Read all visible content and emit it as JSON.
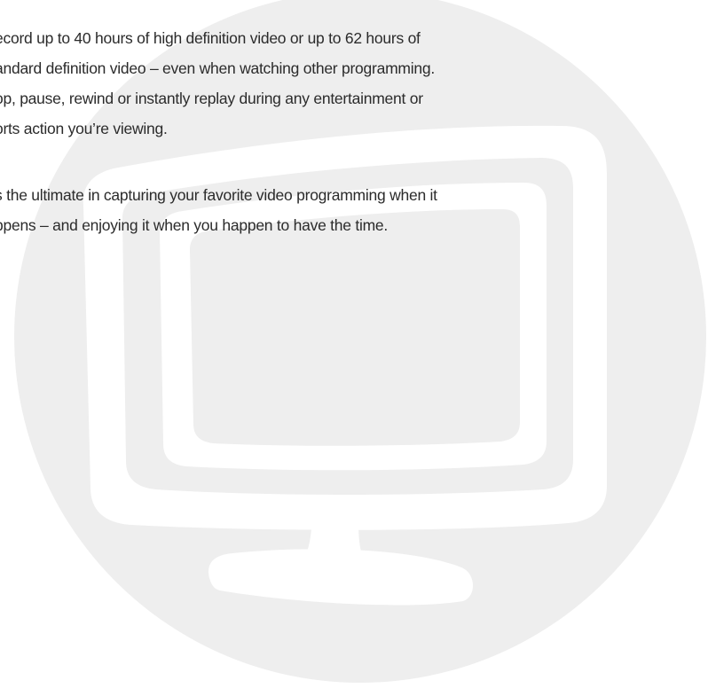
{
  "text": {
    "paragraph1": [
      "ecord up to 40 hours of high definition video or up to 62 hours of",
      "andard definition video – even when watching other programming.",
      "op, pause, rewind or instantly replay during any entertainment or",
      "orts action you’re viewing."
    ],
    "paragraph2": [
      "s the ultimate in capturing your favorite video programming when it",
      "ppens – and enjoying it when you happen to have the time."
    ]
  },
  "graphic": {
    "icon": "tv-monitor-icon",
    "circle_color": "#eeeeee",
    "icon_color": "#ffffff"
  },
  "colors": {
    "background": "#ffffff",
    "text": "#2b2b2b"
  }
}
